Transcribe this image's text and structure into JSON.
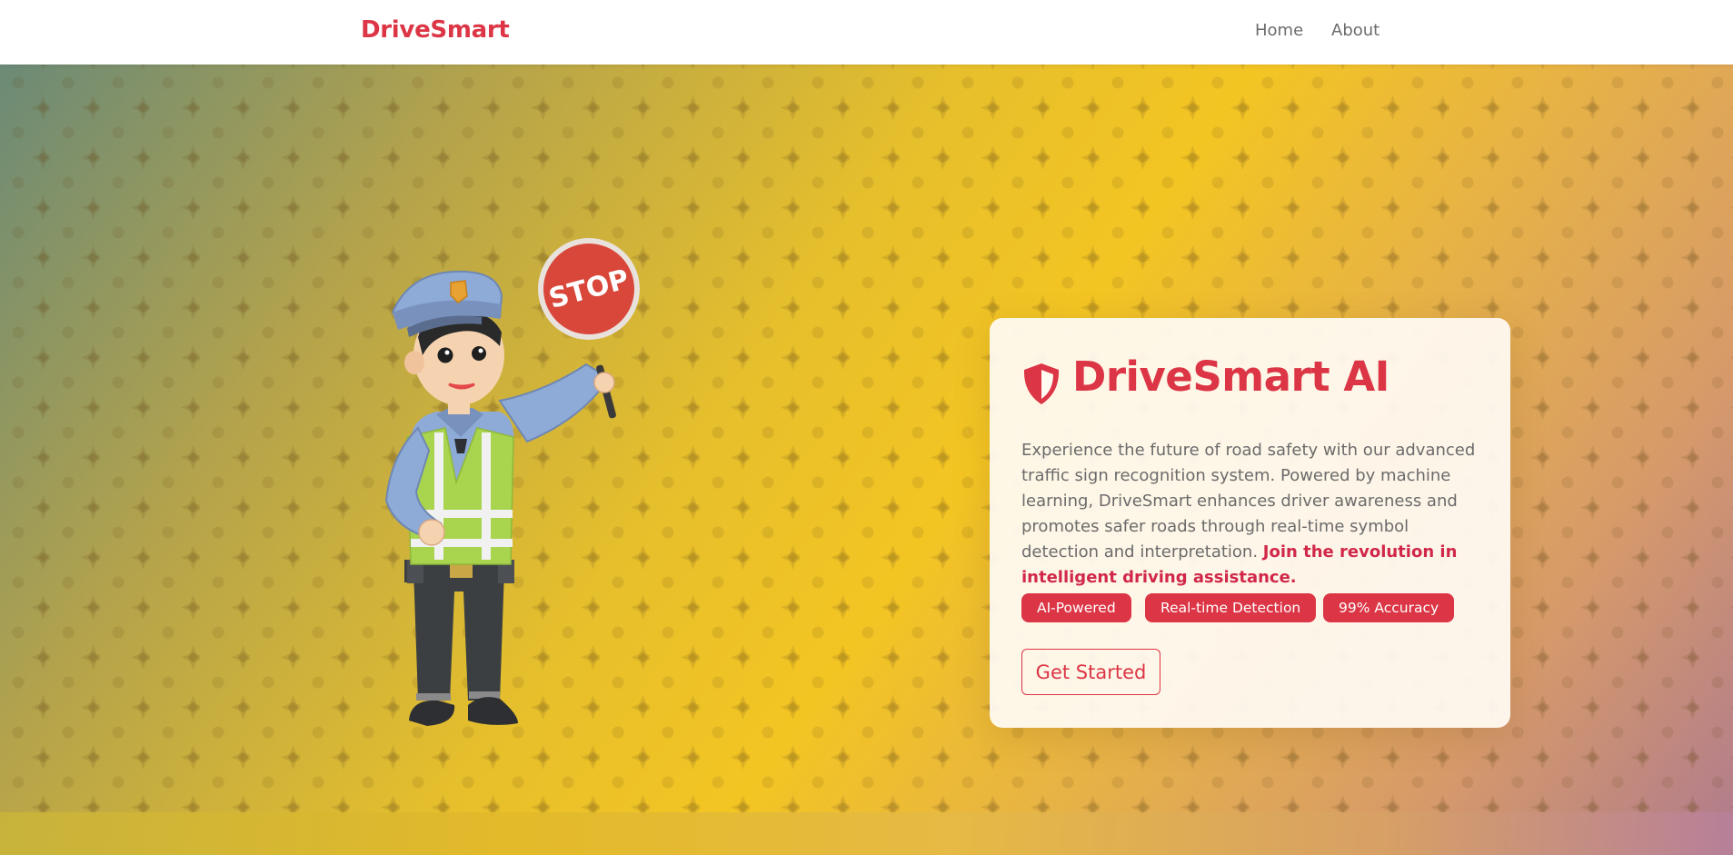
{
  "navbar": {
    "brand": "DriveSmart",
    "links": [
      {
        "label": "Home"
      },
      {
        "label": "About"
      }
    ]
  },
  "hero": {
    "illustration": {
      "subject": "traffic officer",
      "sign_text": "STOP"
    },
    "card": {
      "icon": "shield-icon",
      "title": "DriveSmart AI",
      "description": "Experience the future of road safety with our advanced traffic sign recognition system. Powered by machine learning, DriveSmart enhances driver awareness and promotes safer roads through real-time symbol detection and interpretation.",
      "highlight": "Join the revolution in intelligent driving assistance.",
      "badges": [
        "AI-Powered",
        "Real-time Detection",
        "99% Accuracy"
      ],
      "cta_label": "Get Started"
    }
  },
  "colors": {
    "accent": "#dc3545",
    "nav_text": "#6c6c6c",
    "body_text": "#6b6b6b",
    "card_bg": "#fffaf2"
  }
}
